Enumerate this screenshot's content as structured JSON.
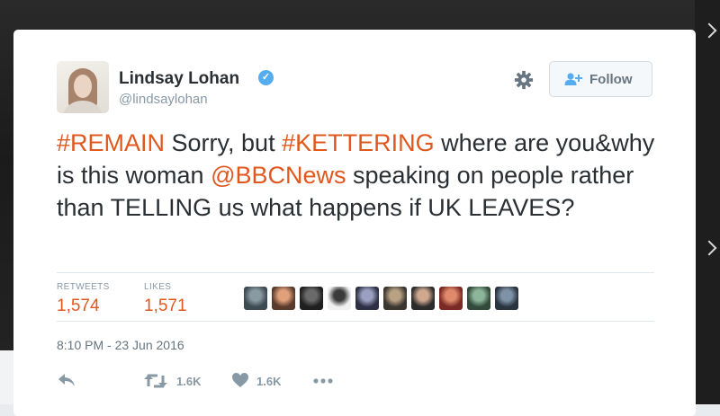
{
  "tweet": {
    "author_name": "Lindsay Lohan",
    "author_handle": "@lindsaylohan",
    "verified_icon": "verified-badge-icon",
    "follow_label": "Follow",
    "text_segments": [
      {
        "text": "#REMAIN",
        "highlight": true
      },
      {
        "text": " Sorry, but ",
        "highlight": false
      },
      {
        "text": "#KETTERING",
        "highlight": true
      },
      {
        "text": " where are you&why is this woman ",
        "highlight": false
      },
      {
        "text": "@BBCNews",
        "highlight": true
      },
      {
        "text": " speaking on people rather than TELLING us what happens if UK LEAVES?",
        "highlight": false
      }
    ],
    "stats": {
      "retweets_label": "RETWEETS",
      "retweets_value": "1,574",
      "likes_label": "LIKES",
      "likes_value": "1,571"
    },
    "liker_avatar_count": 10,
    "timestamp": "8:10 PM - 23 Jun 2016",
    "actions": {
      "retweet_count": "1.6K",
      "like_count": "1.6K"
    }
  },
  "colors": {
    "accent": "#e0581e",
    "verified": "#55acee",
    "muted": "#8899a6",
    "text": "#292f33"
  }
}
